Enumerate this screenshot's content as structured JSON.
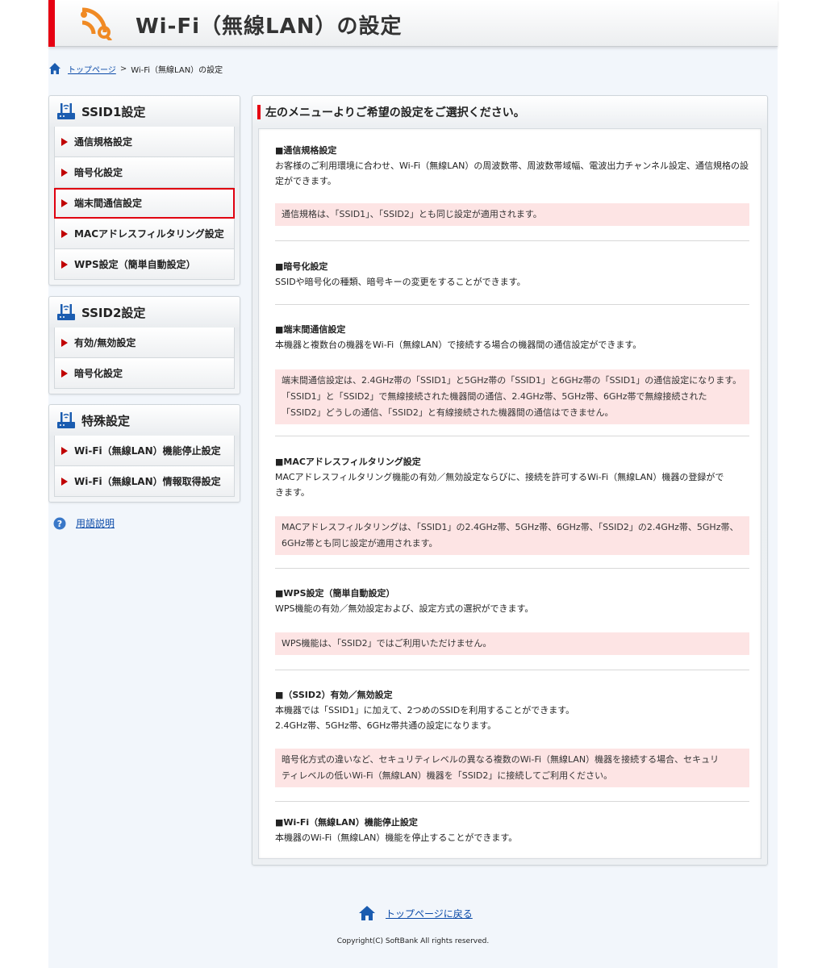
{
  "header": {
    "title": "Wi-Fi（無線LAN）の設定"
  },
  "breadcrumb": {
    "home": "トップページ",
    "separator": ">",
    "current": "Wi-Fi（無線LAN）の設定"
  },
  "sidebar": {
    "ssid1": {
      "title": "SSID1設定",
      "items": [
        "通信規格設定",
        "暗号化設定",
        "端末間通信設定",
        "MACアドレスフィルタリング設定",
        "WPS設定（簡単自動設定）"
      ]
    },
    "ssid2": {
      "title": "SSID2設定",
      "items": [
        "有効/無効設定",
        "暗号化設定"
      ]
    },
    "special": {
      "title": "特殊設定",
      "items": [
        "Wi-Fi（無線LAN）機能停止設定",
        "Wi-Fi（無線LAN）情報取得設定"
      ]
    },
    "help": "用語説明"
  },
  "main": {
    "heading": "左のメニューよりご希望の設定をご選択ください。",
    "sections": [
      {
        "title": "■通信規格設定",
        "body": "お客様のご利用環境に合わせ、Wi-Fi（無線LAN）の周波数帯、周波数帯域幅、電波出力チャンネル設定、通信規格の設定ができます。",
        "note": "通信規格は、「SSID1」、「SSID2」とも同じ設定が適用されます。"
      },
      {
        "title": "■暗号化設定",
        "body": "SSIDや暗号化の種類、暗号キーの変更をすることができます。"
      },
      {
        "title": "■端末間通信設定",
        "body": "本機器と複数台の機器をWi-Fi（無線LAN）で接続する場合の機器間の通信設定ができます。",
        "note_lines": [
          "端末間通信設定は、2.4GHz帯の「SSID1」と5GHz帯の「SSID1」と6GHz帯の「SSID1」の通信設定になります。",
          "「SSID1」と「SSID2」で無線接続された機器間の通信、2.4GHz帯、5GHz帯、6GHz帯で無線接続された",
          "「SSID2」どうしの通信、「SSID2」と有線接続された機器間の通信はできません。"
        ]
      },
      {
        "title": "■MACアドレスフィルタリング設定",
        "body_lines": [
          "MACアドレスフィルタリング機能の有効／無効設定ならびに、接続を許可するWi-Fi（無線LAN）機器の登録がで",
          "きます。"
        ],
        "note_lines": [
          "MACアドレスフィルタリングは、「SSID1」の2.4GHz帯、5GHz帯、6GHz帯、「SSID2」の2.4GHz帯、5GHz帯、",
          "6GHz帯とも同じ設定が適用されます。"
        ]
      },
      {
        "title": "■WPS設定（簡単自動設定）",
        "body": "WPS機能の有効／無効設定および、設定方式の選択ができます。",
        "note": "WPS機能は、「SSID2」ではご利用いただけません。"
      },
      {
        "title": "■（SSID2）有効／無効設定",
        "body_lines": [
          "本機器では「SSID1」に加えて、2つめのSSIDを利用することができます。",
          "2.4GHz帯、5GHz帯、6GHz帯共通の設定になります。"
        ],
        "note_lines": [
          "暗号化方式の違いなど、セキュリティレベルの異なる複数のWi-Fi（無線LAN）機器を接続する場合、セキュリ",
          "ティレベルの低いWi-Fi（無線LAN）機器を「SSID2」に接続してご利用ください。"
        ]
      },
      {
        "title": "■Wi-Fi（無線LAN）機能停止設定",
        "body": "本機器のWi-Fi（無線LAN）機能を停止することができます。"
      }
    ]
  },
  "footer": {
    "back_link": "トップページに戻る",
    "copyright": "Copyright(C) SoftBank All rights reserved."
  },
  "colors": {
    "brand_red": "#e60012",
    "link_blue": "#0a4aa8",
    "note_pink": "#fde4e4"
  },
  "icons": [
    "wifi-wrench-icon",
    "home-icon",
    "router-icon",
    "help-icon"
  ]
}
